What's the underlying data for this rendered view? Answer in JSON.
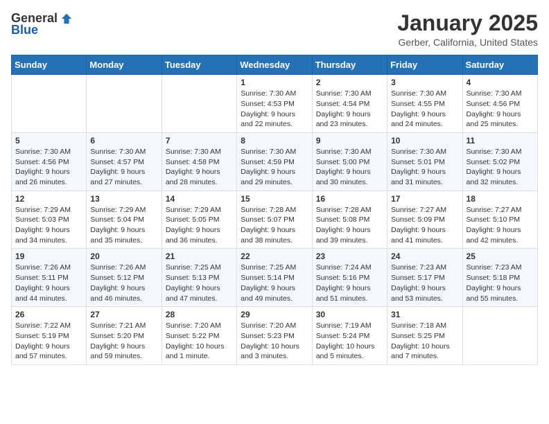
{
  "header": {
    "logo_general": "General",
    "logo_blue": "Blue",
    "month_title": "January 2025",
    "location": "Gerber, California, United States"
  },
  "weekdays": [
    "Sunday",
    "Monday",
    "Tuesday",
    "Wednesday",
    "Thursday",
    "Friday",
    "Saturday"
  ],
  "weeks": [
    [
      {
        "day": "",
        "info": ""
      },
      {
        "day": "",
        "info": ""
      },
      {
        "day": "",
        "info": ""
      },
      {
        "day": "1",
        "info": "Sunrise: 7:30 AM\nSunset: 4:53 PM\nDaylight: 9 hours and 22 minutes."
      },
      {
        "day": "2",
        "info": "Sunrise: 7:30 AM\nSunset: 4:54 PM\nDaylight: 9 hours and 23 minutes."
      },
      {
        "day": "3",
        "info": "Sunrise: 7:30 AM\nSunset: 4:55 PM\nDaylight: 9 hours and 24 minutes."
      },
      {
        "day": "4",
        "info": "Sunrise: 7:30 AM\nSunset: 4:56 PM\nDaylight: 9 hours and 25 minutes."
      }
    ],
    [
      {
        "day": "5",
        "info": "Sunrise: 7:30 AM\nSunset: 4:56 PM\nDaylight: 9 hours and 26 minutes."
      },
      {
        "day": "6",
        "info": "Sunrise: 7:30 AM\nSunset: 4:57 PM\nDaylight: 9 hours and 27 minutes."
      },
      {
        "day": "7",
        "info": "Sunrise: 7:30 AM\nSunset: 4:58 PM\nDaylight: 9 hours and 28 minutes."
      },
      {
        "day": "8",
        "info": "Sunrise: 7:30 AM\nSunset: 4:59 PM\nDaylight: 9 hours and 29 minutes."
      },
      {
        "day": "9",
        "info": "Sunrise: 7:30 AM\nSunset: 5:00 PM\nDaylight: 9 hours and 30 minutes."
      },
      {
        "day": "10",
        "info": "Sunrise: 7:30 AM\nSunset: 5:01 PM\nDaylight: 9 hours and 31 minutes."
      },
      {
        "day": "11",
        "info": "Sunrise: 7:30 AM\nSunset: 5:02 PM\nDaylight: 9 hours and 32 minutes."
      }
    ],
    [
      {
        "day": "12",
        "info": "Sunrise: 7:29 AM\nSunset: 5:03 PM\nDaylight: 9 hours and 34 minutes."
      },
      {
        "day": "13",
        "info": "Sunrise: 7:29 AM\nSunset: 5:04 PM\nDaylight: 9 hours and 35 minutes."
      },
      {
        "day": "14",
        "info": "Sunrise: 7:29 AM\nSunset: 5:05 PM\nDaylight: 9 hours and 36 minutes."
      },
      {
        "day": "15",
        "info": "Sunrise: 7:28 AM\nSunset: 5:07 PM\nDaylight: 9 hours and 38 minutes."
      },
      {
        "day": "16",
        "info": "Sunrise: 7:28 AM\nSunset: 5:08 PM\nDaylight: 9 hours and 39 minutes."
      },
      {
        "day": "17",
        "info": "Sunrise: 7:27 AM\nSunset: 5:09 PM\nDaylight: 9 hours and 41 minutes."
      },
      {
        "day": "18",
        "info": "Sunrise: 7:27 AM\nSunset: 5:10 PM\nDaylight: 9 hours and 42 minutes."
      }
    ],
    [
      {
        "day": "19",
        "info": "Sunrise: 7:26 AM\nSunset: 5:11 PM\nDaylight: 9 hours and 44 minutes."
      },
      {
        "day": "20",
        "info": "Sunrise: 7:26 AM\nSunset: 5:12 PM\nDaylight: 9 hours and 46 minutes."
      },
      {
        "day": "21",
        "info": "Sunrise: 7:25 AM\nSunset: 5:13 PM\nDaylight: 9 hours and 47 minutes."
      },
      {
        "day": "22",
        "info": "Sunrise: 7:25 AM\nSunset: 5:14 PM\nDaylight: 9 hours and 49 minutes."
      },
      {
        "day": "23",
        "info": "Sunrise: 7:24 AM\nSunset: 5:16 PM\nDaylight: 9 hours and 51 minutes."
      },
      {
        "day": "24",
        "info": "Sunrise: 7:23 AM\nSunset: 5:17 PM\nDaylight: 9 hours and 53 minutes."
      },
      {
        "day": "25",
        "info": "Sunrise: 7:23 AM\nSunset: 5:18 PM\nDaylight: 9 hours and 55 minutes."
      }
    ],
    [
      {
        "day": "26",
        "info": "Sunrise: 7:22 AM\nSunset: 5:19 PM\nDaylight: 9 hours and 57 minutes."
      },
      {
        "day": "27",
        "info": "Sunrise: 7:21 AM\nSunset: 5:20 PM\nDaylight: 9 hours and 59 minutes."
      },
      {
        "day": "28",
        "info": "Sunrise: 7:20 AM\nSunset: 5:22 PM\nDaylight: 10 hours and 1 minute."
      },
      {
        "day": "29",
        "info": "Sunrise: 7:20 AM\nSunset: 5:23 PM\nDaylight: 10 hours and 3 minutes."
      },
      {
        "day": "30",
        "info": "Sunrise: 7:19 AM\nSunset: 5:24 PM\nDaylight: 10 hours and 5 minutes."
      },
      {
        "day": "31",
        "info": "Sunrise: 7:18 AM\nSunset: 5:25 PM\nDaylight: 10 hours and 7 minutes."
      },
      {
        "day": "",
        "info": ""
      }
    ]
  ]
}
